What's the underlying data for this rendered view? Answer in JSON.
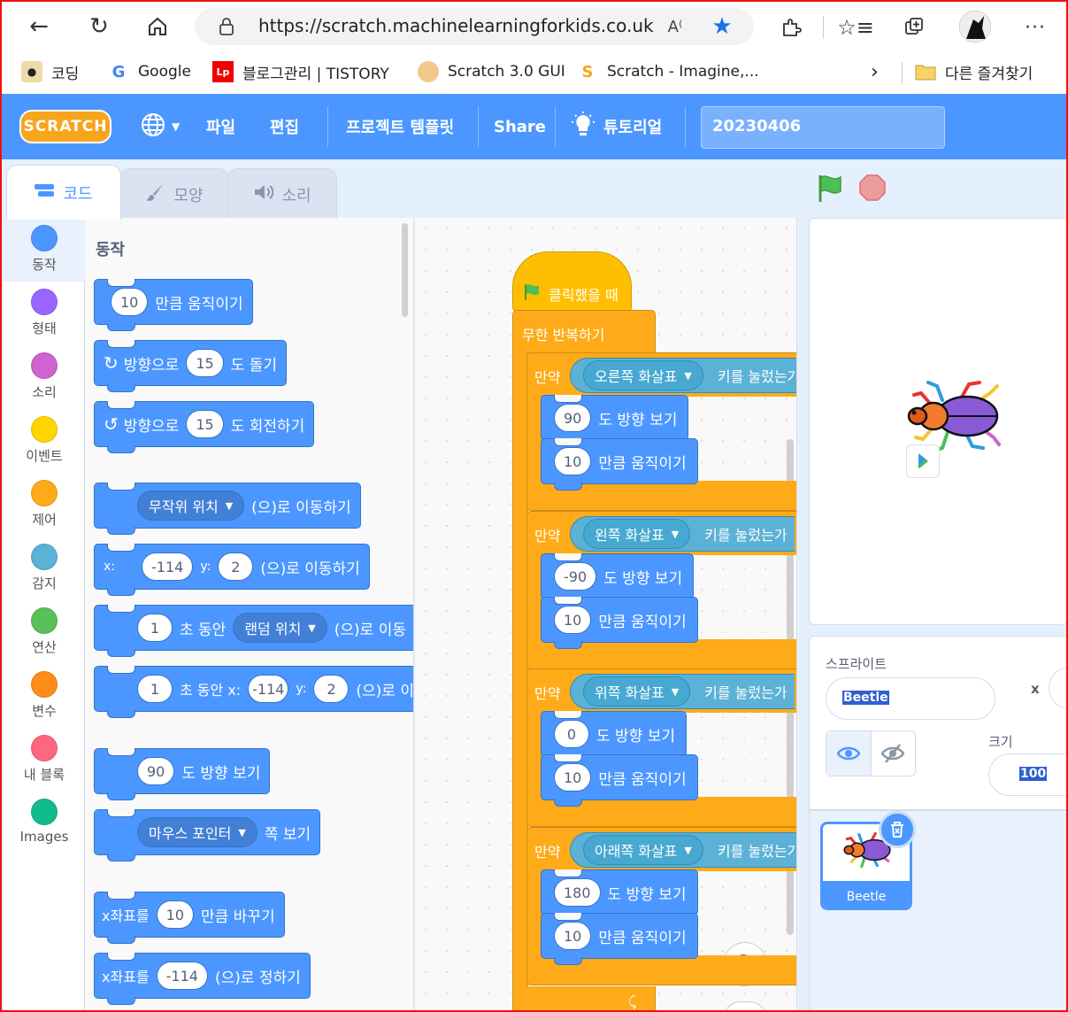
{
  "browser": {
    "url": "https://scratch.machinelearningforkids.co.uk",
    "icons": [
      "back-icon",
      "refresh-icon",
      "home-icon",
      "lock-icon",
      "read-aloud-icon",
      "favorite-star-icon",
      "extensions-icon",
      "favorites-icon",
      "collections-icon",
      "profile-icon",
      "more-icon"
    ]
  },
  "favorites": {
    "items": [
      {
        "label": "코딩",
        "icon": "dog-icon"
      },
      {
        "label": "Google",
        "icon": "google-icon"
      },
      {
        "label": "블로그관리 | TISTORY",
        "icon": "lp-icon",
        "icon_text": "Lp"
      },
      {
        "label": "Scratch 3.0 GUI",
        "icon": "cat-icon"
      },
      {
        "label": "Scratch - Imagine,...",
        "icon": "scratch-s-icon"
      }
    ],
    "other_label": "다른 즐겨찾기"
  },
  "menu": {
    "logo": "SCRATCH",
    "file": "파일",
    "edit": "편집",
    "templates": "프로젝트 템플릿",
    "share": "Share",
    "tutorials": "튜토리얼",
    "project_title": "20230406"
  },
  "tabs": {
    "code": "코드",
    "costumes": "모양",
    "sounds": "소리"
  },
  "categories": [
    {
      "label": "동작",
      "color": "#4c97ff"
    },
    {
      "label": "형태",
      "color": "#9966ff"
    },
    {
      "label": "소리",
      "color": "#cf63cf"
    },
    {
      "label": "이벤트",
      "color": "#ffd500"
    },
    {
      "label": "제어",
      "color": "#ffab19"
    },
    {
      "label": "감지",
      "color": "#5cb1d6"
    },
    {
      "label": "연산",
      "color": "#59c059"
    },
    {
      "label": "변수",
      "color": "#ff8c1a"
    },
    {
      "label": "내 블록",
      "color": "#ff6680"
    },
    {
      "label": "Images",
      "color": "#0fbd8c"
    }
  ],
  "palette": {
    "heading": "동작",
    "move": {
      "value": "10",
      "text": "만큼 움직이기"
    },
    "turn_right": {
      "pre": "방향으로",
      "value": "15",
      "post": "도 돌기"
    },
    "turn_left": {
      "pre": "방향으로",
      "value": "15",
      "post": "도 회전하기"
    },
    "goto": {
      "option": "무작위 위치",
      "post": "(으)로 이동하기"
    },
    "goto_xy": {
      "x_label": "x:",
      "x": "-114",
      "y_label": "y:",
      "y": "2",
      "post": "(으)로 이동하기"
    },
    "glide": {
      "value": "1",
      "mid": "초 동안",
      "option": "랜덤 위치",
      "post": "(으)로 이동"
    },
    "glide_xy": {
      "value": "1",
      "mid": "초 동안 x:",
      "x": "-114",
      "y_label": "y:",
      "y": "2",
      "post": "(으)로 이"
    },
    "point": {
      "value": "90",
      "post": "도 방향 보기"
    },
    "point_towards": {
      "option": "마우스 포인터",
      "post": "쪽 보기"
    },
    "change_x": {
      "pre": "x좌표를",
      "value": "10",
      "post": "만큼 바꾸기"
    },
    "set_x": {
      "pre": "x좌표를",
      "value": "-114",
      "post": "(으)로 정하기"
    }
  },
  "script": {
    "hat": "클릭했을 때",
    "forever": "무한 반복하기",
    "if_label": "만약",
    "key_pressed": "키를 눌렀는가",
    "ifs": [
      {
        "key": "오른쪽 화살표",
        "dir": "90",
        "move": "10"
      },
      {
        "key": "왼쪽 화살표",
        "dir": "-90",
        "move": "10"
      },
      {
        "key": "위쪽 화살표",
        "dir": "0",
        "move": "10"
      },
      {
        "key": "아래쪽 화살표",
        "dir": "180",
        "move": "10"
      }
    ],
    "dir_text": "도 방향 보기",
    "move_text": "만큼 움직이기"
  },
  "sprite": {
    "label": "스프라이트",
    "name": "Beetle",
    "x_label": "x",
    "size_label": "크기",
    "size": "100",
    "thumb_name": "Beetle"
  },
  "colors": {
    "scratch_blue": "#4c97ff",
    "control_orange": "#ffab19",
    "sensing": "#5cb1d6"
  }
}
